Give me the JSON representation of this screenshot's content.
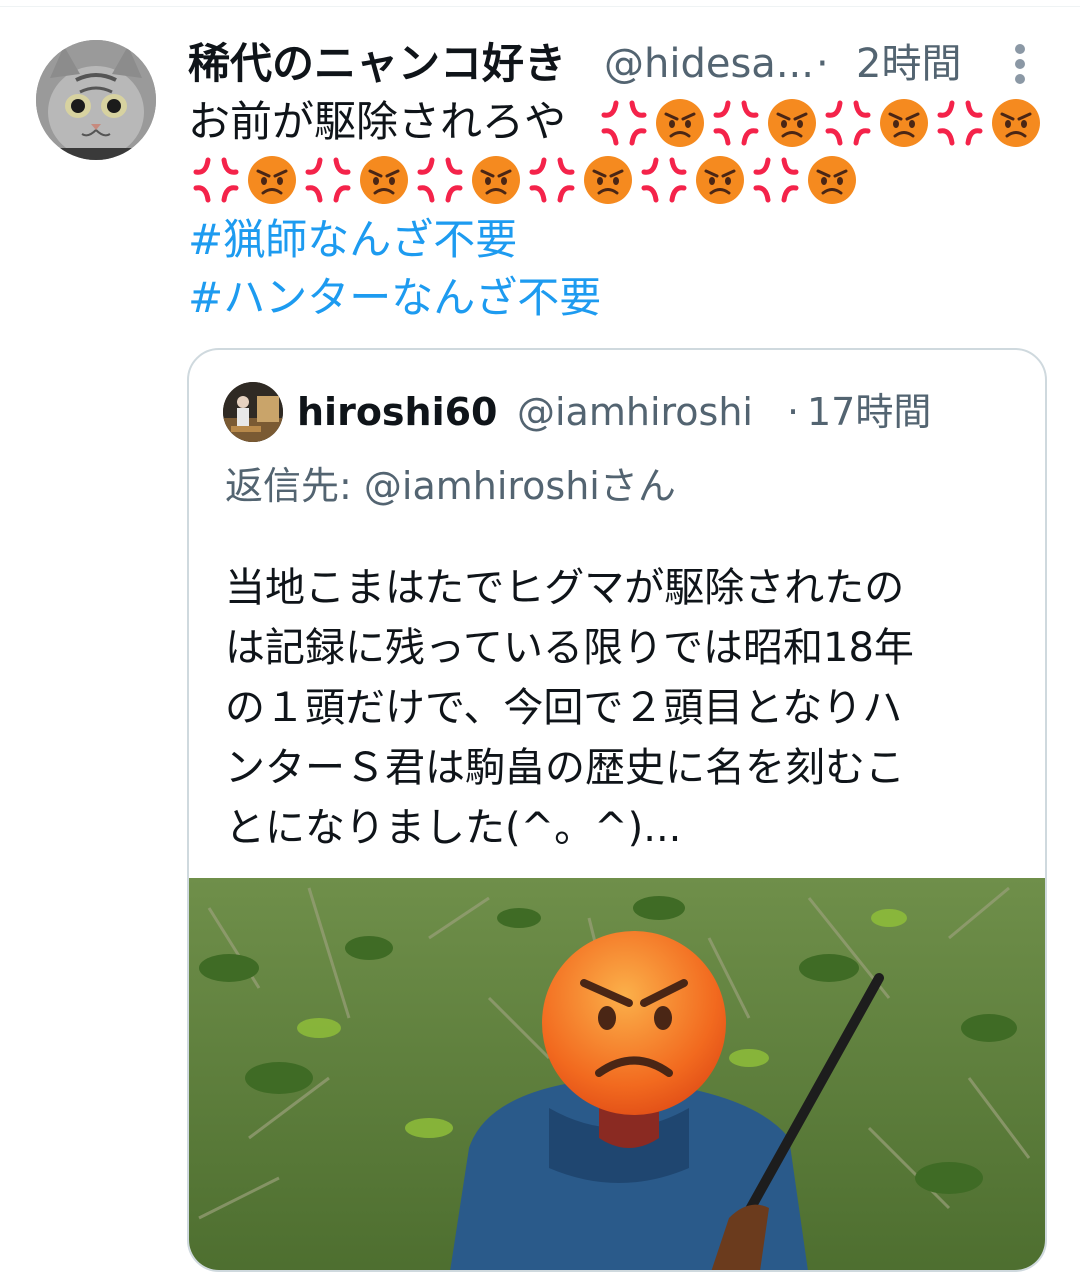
{
  "tweet": {
    "display_name": "稀代のニャンコ好き",
    "handle": "@hidesa...",
    "separator": "·",
    "time": "2時間",
    "text_line1": "お前が駆除されろや",
    "emoji_sequence_line1": [
      "anger-symbol",
      "angry-face",
      "anger-symbol",
      "angry-face",
      "anger-symbol",
      "angry-face",
      "anger-symbol",
      "angry-face"
    ],
    "emoji_sequence_line2": [
      "anger-symbol",
      "angry-face",
      "anger-symbol",
      "angry-face",
      "anger-symbol",
      "angry-face",
      "anger-symbol",
      "angry-face",
      "anger-symbol",
      "angry-face",
      "anger-symbol",
      "angry-face"
    ],
    "hashtags": [
      "#猟師なんざ不要",
      "#ハンターなんざ不要"
    ],
    "icons": {
      "avatar": "cat-avatar",
      "more": "more-vertical-icon"
    },
    "colors": {
      "text": "#0f1419",
      "secondary": "#536471",
      "link": "#1d9bf0",
      "border": "#cfd9de",
      "anger_symbol": "#f4234a",
      "angry_face": "#f58a1f"
    }
  },
  "quoted_tweet": {
    "display_name": "hiroshi60",
    "handle": "@iamhiroshi",
    "separator": "·",
    "time": "17時間",
    "reply_to": "返信先: @iamhiroshiさん",
    "body_lines": [
      "当地こまはたでヒグマが駆除されたの",
      "は記録に残っている限りでは昭和18年",
      "の１頭だけで、今回で２頭目となりハ",
      "ンターＳ君は駒畠の歴史に名を刻むこ",
      "とになりました(^。^)..."
    ],
    "photo": "hunter-with-rifle-face-covered-by-angry-emoji-photo"
  }
}
